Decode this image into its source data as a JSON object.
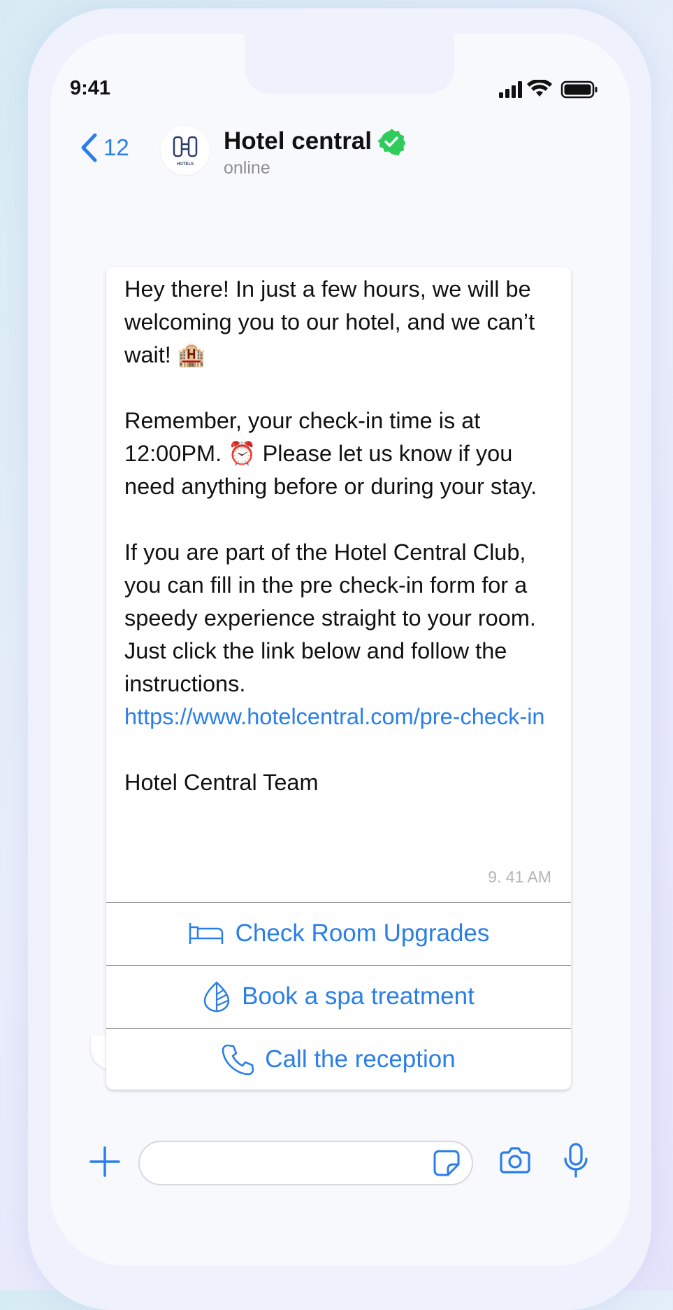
{
  "status_bar": {
    "time": "9:41"
  },
  "header": {
    "back_count": "12",
    "contact_name": "Hotel central",
    "contact_status": "online",
    "avatar_label": "HOTELS"
  },
  "message": {
    "paragraphs": [
      "Hey there! In just a few hours, we will be welcoming you to our hotel, and we can’t wait! 🏨",
      "Remember, your check-in time is at 12:00PM. ⏰ Please let us know if you need anything before or during your stay.",
      "If you are part of the Hotel Central Club, you can fill in the pre check-in form for a speedy experience straight to your room. Just click the link below and follow the instructions."
    ],
    "link": "https://www.hotelcentral.com/pre-check-in",
    "signature": "Hotel Central Team",
    "time": "9. 41 AM"
  },
  "actions": [
    {
      "label": "Check Room Upgrades",
      "icon": "bed-icon"
    },
    {
      "label": "Book a spa treatment",
      "icon": "leaf-icon"
    },
    {
      "label": "Call the reception",
      "icon": "phone-icon"
    }
  ],
  "colors": {
    "accent": "#2a7ee8",
    "verified": "#2ecc5a",
    "background": "#f8f9fd"
  }
}
